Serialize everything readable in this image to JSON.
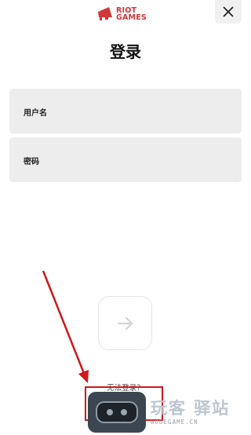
{
  "header": {
    "logo_line1": "RIOT",
    "logo_line2": "GAMES",
    "brand_color": "#d13639",
    "close_icon": "close-icon"
  },
  "page": {
    "title": "登录"
  },
  "form": {
    "username_label": "用户名",
    "password_label": "密码",
    "submit_icon": "arrow-right-icon"
  },
  "footer": {
    "trouble_link": "无法登录？"
  },
  "watermark": {
    "main": "玩客 驿站",
    "sub": "WODEGAME.CN"
  },
  "annotation": {
    "color": "#d4161b"
  }
}
